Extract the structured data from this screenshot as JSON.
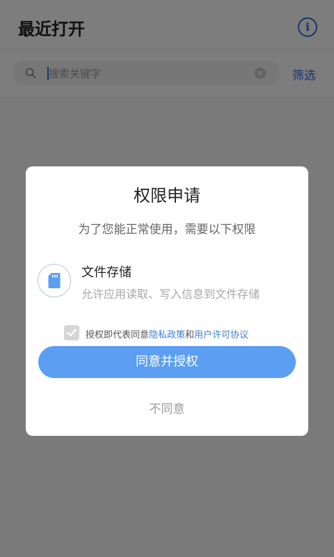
{
  "header": {
    "title": "最近打开",
    "info_icon_glyph": "i"
  },
  "search": {
    "placeholder": "搜索关键字",
    "filter_label": "筛选",
    "clear_glyph": "×"
  },
  "dialog": {
    "title": "权限申请",
    "subtitle": "为了您能正常使用，需要以下权限",
    "permission": {
      "icon": "sd-card-icon",
      "name": "文件存储",
      "description": "允许应用读取、写入信息到文件存储"
    },
    "consent": {
      "checked": true,
      "prefix": "授权即代表同意",
      "privacy_link": "隐私政策",
      "conjunction": "和",
      "license_link": "用户许可协议"
    },
    "agree_button": "同意并授权",
    "disagree_button": "不同意"
  },
  "colors": {
    "accent": "#2a6dd8",
    "button": "#5b9ef2",
    "link": "#3b7fd9"
  }
}
